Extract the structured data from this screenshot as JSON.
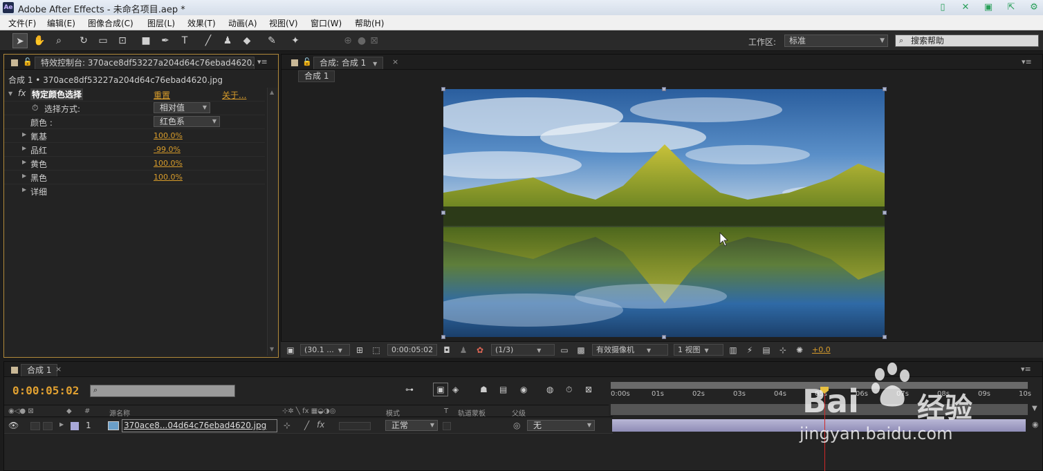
{
  "titlebar": {
    "app_icon_text": "Ae",
    "title": "Adobe After Effects - 未命名项目.aep *"
  },
  "menu": [
    "文件(F)",
    "编辑(E)",
    "图像合成(C)",
    "图层(L)",
    "效果(T)",
    "动画(A)",
    "视图(V)",
    "窗口(W)",
    "帮助(H)"
  ],
  "toolbar": {
    "workspace_label": "工作区:",
    "workspace_value": "标准",
    "help_placeholder": "搜索帮助"
  },
  "effect_panel": {
    "tab_label": "特效控制台: 370ace8df53227a204d64c76ebad4620.jp",
    "subtitle": "合成 1 • 370ace8df53227a204d64c76ebad4620.jpg",
    "effect_name": "特定颜色选择",
    "reset": "重置",
    "about": "关于...",
    "select_method_label": "选择方式:",
    "select_method_value": "相对值",
    "color_label": "颜色 :",
    "color_value": "红色系",
    "params": [
      {
        "label": "氰基",
        "value": "100.0%"
      },
      {
        "label": "品红",
        "value": "-99.0%"
      },
      {
        "label": "黄色",
        "value": "100.0%"
      },
      {
        "label": "黑色",
        "value": "100.0%"
      }
    ],
    "detail_label": "详细"
  },
  "comp_panel": {
    "tab_label": "合成: 合成 1",
    "breadcrumb": "合成 1",
    "zoom": "(30.1 ...",
    "timecode": "0:00:05:02",
    "resolution": "(1/3)",
    "camera": "有效摄像机",
    "views": "1 视图",
    "exposure": "+0.0"
  },
  "timeline": {
    "tab_label": "合成 1",
    "current_time": "0:00:05:02",
    "columns": {
      "source_name": "源名称",
      "mode": "模式",
      "t": "T",
      "track_matte": "轨道蒙板",
      "parent": "父级",
      "num": "#"
    },
    "layer": {
      "index": "1",
      "name": "370ace8...04d64c76ebad4620.jpg",
      "mode": "正常",
      "parent": "无"
    },
    "ruler_ticks": [
      "0:00s",
      "01s",
      "02s",
      "03s",
      "04s",
      "05s",
      "06s",
      "07s",
      "08s",
      "09s",
      "10s"
    ]
  },
  "watermark": {
    "brand_left": "Bai",
    "brand_right": "经验",
    "url": "jingyan.baidu.com"
  },
  "colors": {
    "accent_orange": "#e0a031",
    "value_orange": "#d99d2b",
    "playhead_red": "#d02828",
    "track_purple": "#a09ec6"
  }
}
